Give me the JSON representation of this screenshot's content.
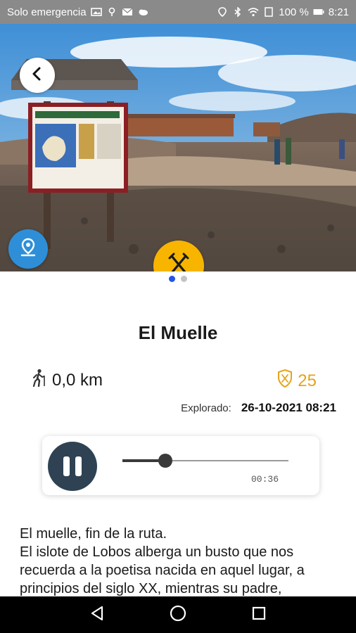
{
  "status_bar": {
    "carrier": "Solo emergencia",
    "battery": "100 %",
    "time": "8:21"
  },
  "place": {
    "title": "El Muelle",
    "distance": "0,0 km",
    "points": "25",
    "explored_label": "Explorado:",
    "explored_value": "26-10-2021 08:21"
  },
  "gallery": {
    "page_count": 2,
    "current_page": 1
  },
  "audio": {
    "elapsed": "00:36",
    "progress": 0.26
  },
  "description": {
    "lines": [
      "El muelle, fin de la ruta.",
      "El islote de Lobos alberga un busto que nos recuerda a la poetisa nacida en aquel lugar, a principios del siglo XX, mientras su padre,"
    ]
  },
  "colors": {
    "accent_blue": "#2e8fd8",
    "accent_yellow": "#f7b500",
    "player_dark": "#2e4253",
    "points_orange": "#e7a21a"
  },
  "icons": {
    "back": "arrow-left-icon",
    "map_pin": "map-pin-icon",
    "tools": "crossed-tools-icon",
    "hiker": "hiker-icon",
    "shield": "shield-badge-icon"
  }
}
